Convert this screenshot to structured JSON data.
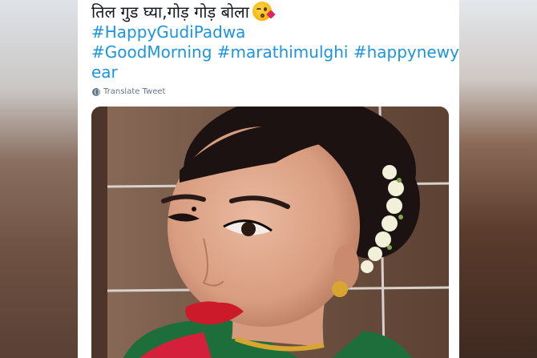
{
  "tweet": {
    "line1": "तिल गुड घ्या,गोड़ गोड़ बोला",
    "emoji": "face-blowing-a-kiss-emoji",
    "hashtags_line1": [
      "#HappyGudiPadwa"
    ],
    "hashtags_line2": [
      "#GoodMorning",
      "#marathimulghi",
      "#happynewy"
    ],
    "hashtags_line3": [
      "ear"
    ],
    "translate_label": "Translate Tweet"
  },
  "colors": {
    "link": "#1b95e0",
    "text": "#14171a",
    "muted": "#657786"
  },
  "photo": {
    "subject": "woman-portrait-selfie-photo"
  }
}
